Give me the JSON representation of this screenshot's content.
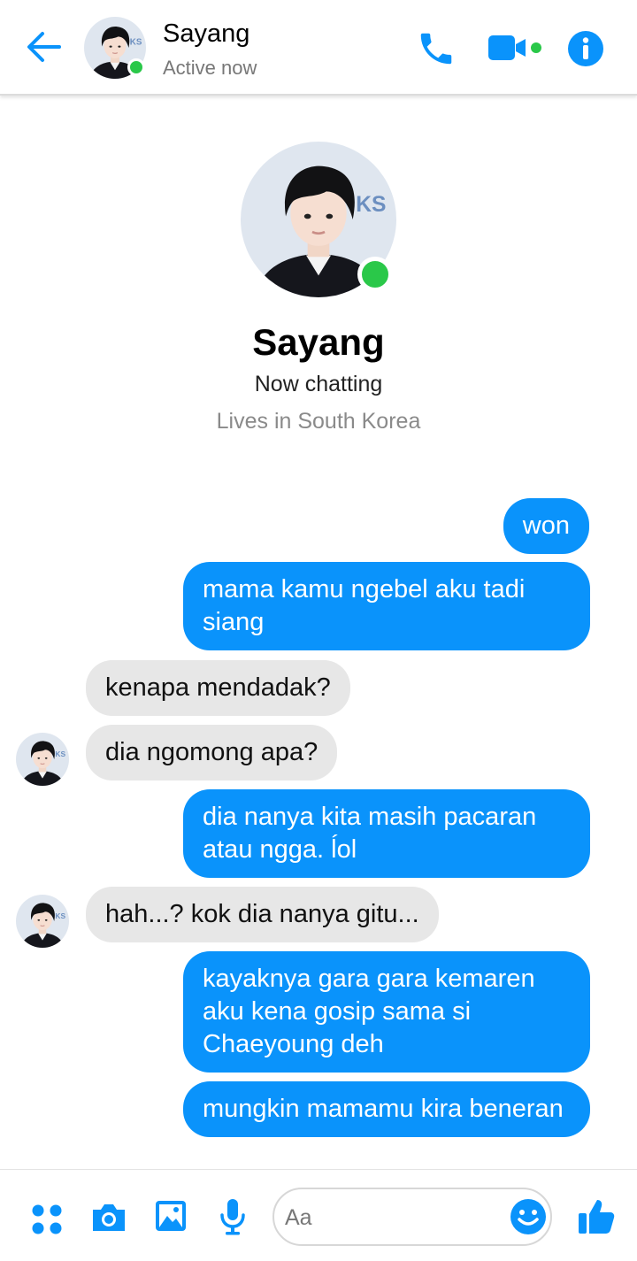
{
  "header": {
    "contact_name": "Sayang",
    "status": "Active now"
  },
  "profile": {
    "name": "Sayang",
    "subtitle": "Now chatting",
    "location": "Lives in South Korea"
  },
  "messages": [
    {
      "direction": "sent",
      "text": "won"
    },
    {
      "direction": "sent",
      "text": "mama kamu ngebel aku tadi siang"
    },
    {
      "direction": "received",
      "text": "kenapa mendadak?"
    },
    {
      "direction": "received",
      "text": "dia ngomong apa?"
    },
    {
      "direction": "sent",
      "text": "dia nanya kita masih pacaran atau ngga. ĺol"
    },
    {
      "direction": "received",
      "text": "hah...? kok dia nanya gitu..."
    },
    {
      "direction": "sent",
      "text": "kayaknya gara gara kemaren aku kena gosip sama si Chaeyoung deh"
    },
    {
      "direction": "sent",
      "text": "mungkin mamamu kira beneran"
    }
  ],
  "composer": {
    "placeholder": "Aa"
  },
  "icons": {
    "back": "arrow-left-icon",
    "call": "phone-icon",
    "video": "video-camera-icon",
    "info": "info-icon",
    "more": "grid-dots-icon",
    "camera": "camera-icon",
    "gallery": "image-icon",
    "voice": "microphone-icon",
    "emoji": "smiley-icon",
    "like": "thumbs-up-icon"
  },
  "colors": {
    "accent": "#0a93fb",
    "presence": "#2ac849",
    "received_bubble": "#e7e7e7"
  }
}
